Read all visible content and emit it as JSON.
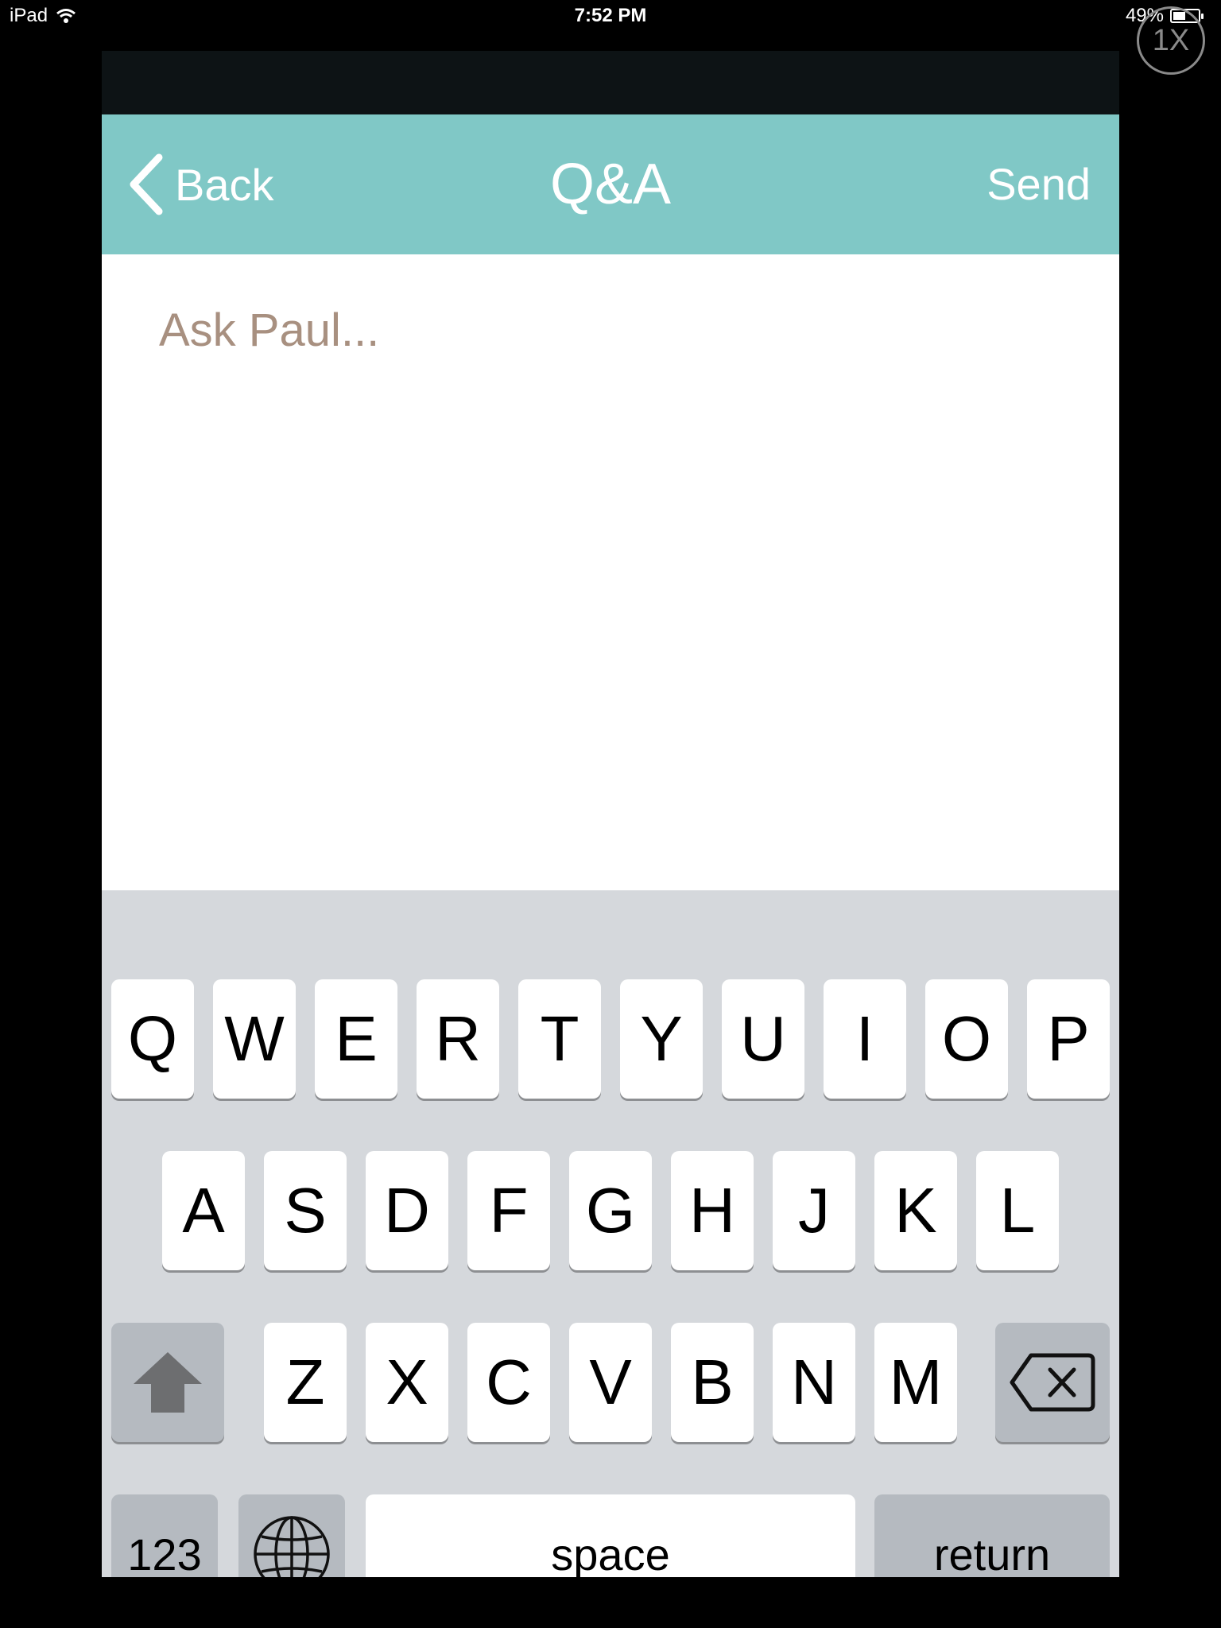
{
  "status": {
    "device": "iPad",
    "time": "7:52 PM",
    "battery": "49%",
    "battery_level": 0.49
  },
  "zoom": {
    "label": "1X"
  },
  "nav": {
    "back_label": "Back",
    "title": "Q&A",
    "send_label": "Send"
  },
  "compose": {
    "placeholder": "Ask Paul...",
    "value": ""
  },
  "keyboard": {
    "row1": [
      "Q",
      "W",
      "E",
      "R",
      "T",
      "Y",
      "U",
      "I",
      "O",
      "P"
    ],
    "row2": [
      "A",
      "S",
      "D",
      "F",
      "G",
      "H",
      "J",
      "K",
      "L"
    ],
    "row3": [
      "Z",
      "X",
      "C",
      "V",
      "B",
      "N",
      "M"
    ],
    "numbers_label": "123",
    "space_label": "space",
    "return_label": "return"
  },
  "colors": {
    "nav_bg": "#80c8c6",
    "placeholder": "#a89080",
    "keyboard_bg": "#d5d8dc"
  }
}
